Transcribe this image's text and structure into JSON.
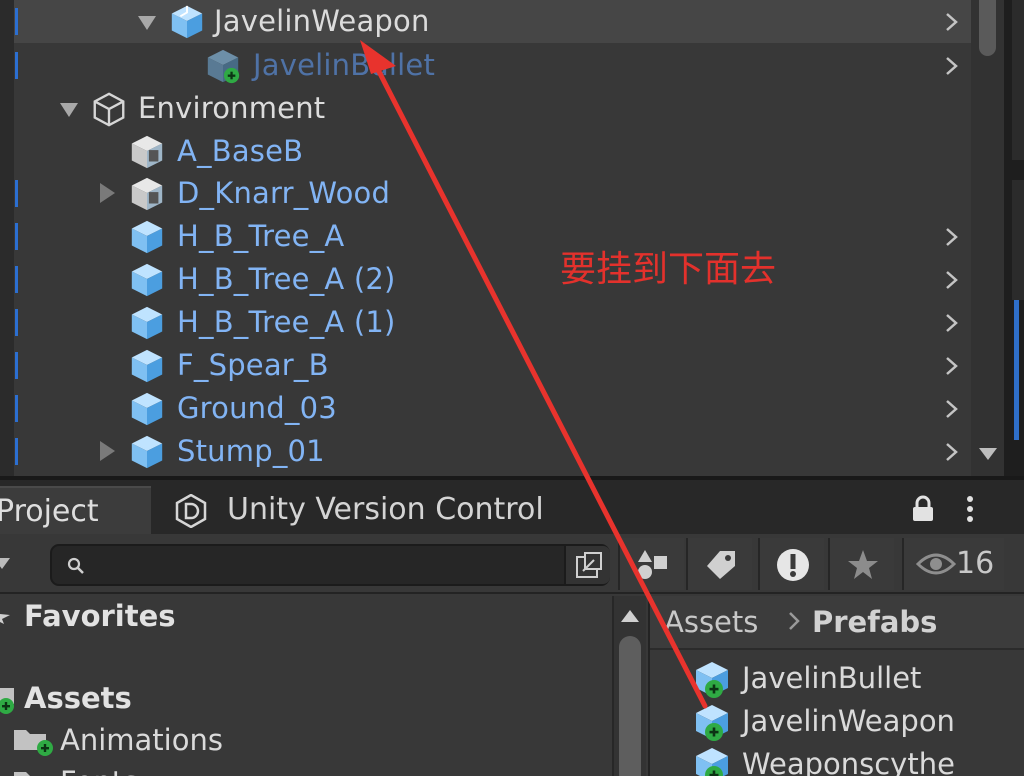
{
  "hierarchy": {
    "items": [
      {
        "label": "JavelinWeapon",
        "color": "white"
      },
      {
        "label": "JavelinBullet",
        "color": "dim"
      },
      {
        "label": "Environment",
        "color": "white"
      },
      {
        "label": "A_BaseB",
        "color": "blue"
      },
      {
        "label": "D_Knarr_Wood",
        "color": "blue"
      },
      {
        "label": "H_B_Tree_A",
        "color": "blue"
      },
      {
        "label": "H_B_Tree_A (2)",
        "color": "blue"
      },
      {
        "label": "H_B_Tree_A (1)",
        "color": "blue"
      },
      {
        "label": "F_Spear_B",
        "color": "blue"
      },
      {
        "label": "Ground_03",
        "color": "blue"
      },
      {
        "label": "Stump_01",
        "color": "blue"
      }
    ]
  },
  "annotation": {
    "text": "要挂到下面去",
    "color": "#e3312c"
  },
  "project": {
    "tabs": {
      "project": "Project",
      "version_control": "Unity Version Control"
    },
    "search": {
      "value": "",
      "placeholder": ""
    },
    "hidden_packages_count": "16",
    "tree": {
      "favorites": "Favorites",
      "assets": "Assets",
      "animations": "Animations",
      "fonts": "Fonts"
    },
    "breadcrumb": {
      "root": "Assets",
      "current": "Prefabs"
    },
    "assets": [
      {
        "name": "JavelinBullet"
      },
      {
        "name": "JavelinWeapon"
      },
      {
        "name": "Weaponscythe"
      }
    ]
  },
  "colors": {
    "prefab_blue": "#82b4f4",
    "selection_mark": "#2c6fd1",
    "annotation_red": "#e3312c"
  }
}
